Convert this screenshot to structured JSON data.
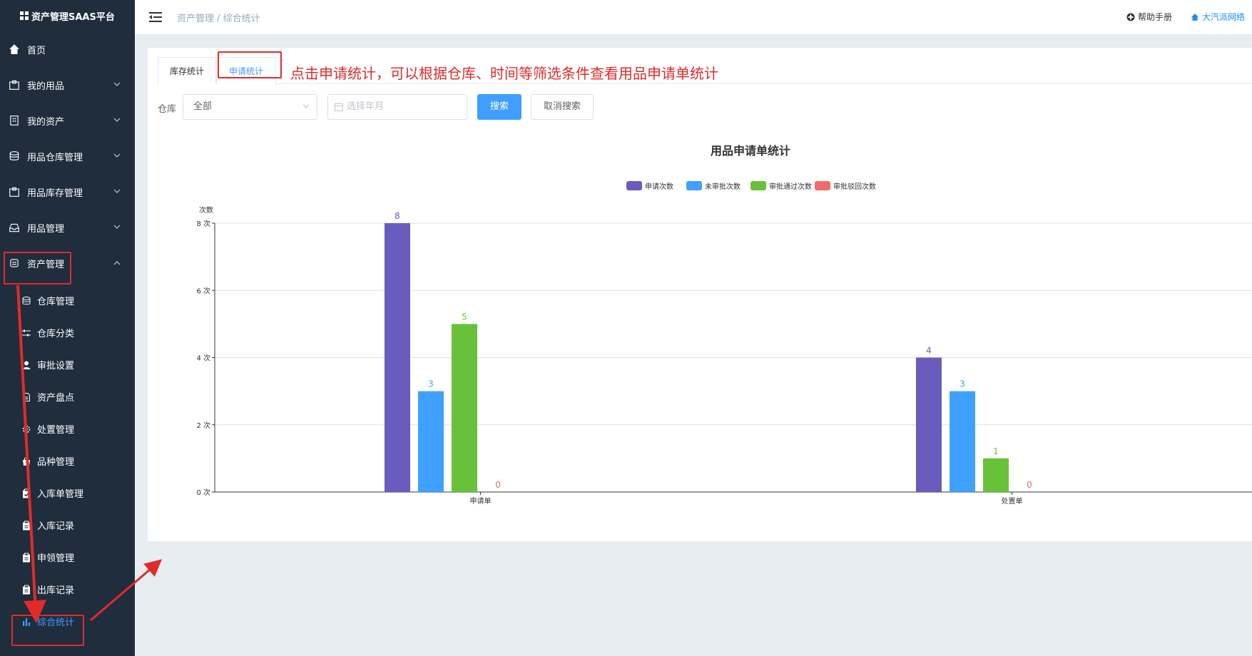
{
  "brand": {
    "title": "资产管理SAAS平台"
  },
  "sidebar": {
    "items": [
      {
        "label": "首页",
        "icon": "home-icon",
        "has_arrow": false
      },
      {
        "label": "我的用品",
        "icon": "box-icon",
        "has_arrow": true
      },
      {
        "label": "我的资产",
        "icon": "building-icon",
        "has_arrow": true
      },
      {
        "label": "用品仓库管理",
        "icon": "database-icon",
        "has_arrow": true
      },
      {
        "label": "用品库存管理",
        "icon": "box-icon",
        "has_arrow": true
      },
      {
        "label": "用品管理",
        "icon": "tray-icon",
        "has_arrow": true
      },
      {
        "label": "资产管理",
        "icon": "asset-icon",
        "has_arrow": true,
        "expanded": true
      }
    ],
    "sub_items": [
      {
        "label": "仓库管理",
        "icon": "database-icon"
      },
      {
        "label": "仓库分类",
        "icon": "sliders-icon"
      },
      {
        "label": "审批设置",
        "icon": "user-icon"
      },
      {
        "label": "资产盘点",
        "icon": "document-icon"
      },
      {
        "label": "处置管理",
        "icon": "gear-icon"
      },
      {
        "label": "品种管理",
        "icon": "bag-icon"
      },
      {
        "label": "入库单管理",
        "icon": "clipboard-check-icon"
      },
      {
        "label": "入库记录",
        "icon": "clipboard-icon"
      },
      {
        "label": "申领管理",
        "icon": "clipboard-icon"
      },
      {
        "label": "出库记录",
        "icon": "clipboard-icon"
      },
      {
        "label": "综合统计",
        "icon": "bar-chart-icon",
        "active": true
      }
    ]
  },
  "header": {
    "breadcrumb_parent": "资产管理",
    "breadcrumb_sep": "/",
    "breadcrumb_current": "综合统计",
    "help_label": "帮助手册",
    "org_label": "大汽派网络"
  },
  "tabs": [
    {
      "label": "库存统计",
      "active": false
    },
    {
      "label": "申请统计",
      "active": true
    }
  ],
  "annotation": "点击申请统计，可以根据仓库、时间等筛选条件查看用品申请单统计",
  "filters": {
    "warehouse_label": "仓库",
    "warehouse_value": "全部",
    "date_placeholder": "选择年月",
    "search_label": "搜索",
    "cancel_label": "取消搜索"
  },
  "colors": {
    "sidebar_bg": "#1f2d3d",
    "accent": "#409eff",
    "annotation_red": "#e12b2b",
    "series": [
      "#6a5cbd",
      "#40a0ff",
      "#67c23a",
      "#f06b6b"
    ]
  },
  "chart_data": {
    "type": "bar",
    "title": "用品申请单统计",
    "ylabel": "次数",
    "y_tick_suffix": " 次",
    "ylim": [
      0,
      8
    ],
    "y_ticks": [
      0,
      2,
      4,
      6,
      8
    ],
    "categories": [
      "申请单",
      "处置单"
    ],
    "legend_position": "top-center",
    "grid": true,
    "series": [
      {
        "name": "申请次数",
        "values": [
          8,
          4
        ]
      },
      {
        "name": "未审批次数",
        "values": [
          3,
          3
        ]
      },
      {
        "name": "审批通过次数",
        "values": [
          5,
          1
        ]
      },
      {
        "name": "审批驳回次数",
        "values": [
          0,
          0
        ]
      }
    ]
  }
}
